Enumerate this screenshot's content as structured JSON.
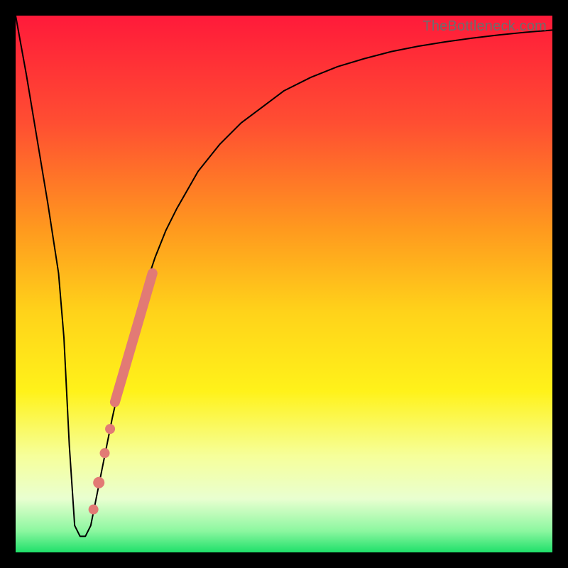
{
  "watermark": "TheBottleneck.com",
  "chart_data": {
    "type": "line",
    "title": "",
    "xlabel": "",
    "ylabel": "",
    "xlim": [
      0,
      100
    ],
    "ylim": [
      0,
      100
    ],
    "grid": false,
    "background_gradient": {
      "stops": [
        {
          "offset": 0.0,
          "color": "#ff1a3a"
        },
        {
          "offset": 0.2,
          "color": "#ff4e32"
        },
        {
          "offset": 0.4,
          "color": "#ff9a1e"
        },
        {
          "offset": 0.55,
          "color": "#ffd21a"
        },
        {
          "offset": 0.7,
          "color": "#fff21a"
        },
        {
          "offset": 0.82,
          "color": "#f6ff9a"
        },
        {
          "offset": 0.9,
          "color": "#e9ffd0"
        },
        {
          "offset": 0.96,
          "color": "#8cf7a0"
        },
        {
          "offset": 1.0,
          "color": "#1fe06a"
        }
      ]
    },
    "series": [
      {
        "name": "bottleneck-curve",
        "color": "#000000",
        "stroke_width": 2,
        "x": [
          0,
          2,
          4,
          6,
          8,
          9,
          10,
          11,
          12,
          13,
          14,
          16,
          18,
          20,
          22,
          24,
          26,
          28,
          30,
          34,
          38,
          42,
          46,
          50,
          55,
          60,
          65,
          70,
          75,
          80,
          85,
          90,
          95,
          100
        ],
        "y": [
          100,
          89,
          77,
          65,
          52,
          40,
          20,
          5,
          3,
          3,
          5,
          15,
          25,
          34,
          42,
          49,
          55,
          60,
          64,
          71,
          76,
          80,
          83,
          86,
          88.5,
          90.5,
          92,
          93.3,
          94.3,
          95.1,
          95.8,
          96.4,
          96.9,
          97.3
        ]
      }
    ],
    "highlights": [
      {
        "name": "thick-segment",
        "color": "#e27a75",
        "stroke_width": 14,
        "x": [
          18.5,
          25.5
        ],
        "y": [
          28,
          52
        ]
      },
      {
        "name": "dot-1",
        "type": "point",
        "color": "#e27a75",
        "radius": 7,
        "x": 17.6,
        "y": 23
      },
      {
        "name": "dot-2",
        "type": "point",
        "color": "#e27a75",
        "radius": 7,
        "x": 16.6,
        "y": 18.5
      },
      {
        "name": "dot-3",
        "type": "point",
        "color": "#e27a75",
        "radius": 8,
        "x": 15.5,
        "y": 13
      },
      {
        "name": "dot-4",
        "type": "point",
        "color": "#e27a75",
        "radius": 7,
        "x": 14.5,
        "y": 8
      }
    ]
  }
}
